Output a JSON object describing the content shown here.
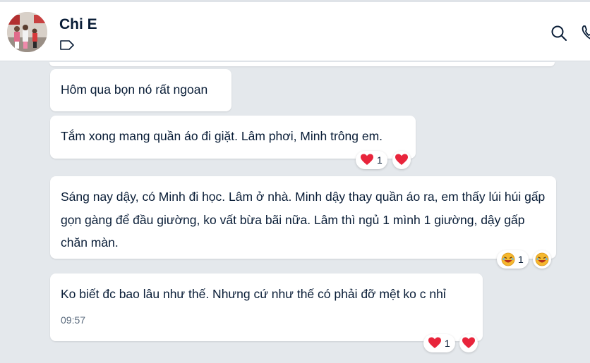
{
  "header": {
    "contact_name": "Chi E",
    "avatar_icon": "avatar-photo",
    "tag_icon": "tag-icon",
    "actions": [
      "search-icon",
      "call-icon"
    ]
  },
  "messages": [
    {
      "text": "Hôm qua bọn nó rất ngoan"
    },
    {
      "text": "Tắm xong mang quần áo đi giặt. Lâm phơi, Minh trông em.",
      "reaction": {
        "emoji": "heart",
        "count": "1"
      }
    },
    {
      "text": "Sáng nay dậy, có Minh đi học. Lâm ở nhà. Minh dậy thay quần áo ra, em thấy lúi húi gấp gọn gàng để đầu giường, ko vất bừa bãi nữa. Lâm thì ngủ 1 mình 1 giường, dậy gấp chăn màn.",
      "reaction": {
        "emoji": "laughing",
        "count": "1"
      }
    },
    {
      "text": "Ko biết đc bao lâu như thế. Nhưng cứ như thế có phải đỡ mệt ko c nhỉ",
      "time": "09:57",
      "reaction": {
        "emoji": "heart",
        "count": "1"
      }
    }
  ],
  "colors": {
    "background": "#e4e8ec",
    "bubble": "#ffffff",
    "text": "#081c36",
    "heart": "#e8243b"
  }
}
